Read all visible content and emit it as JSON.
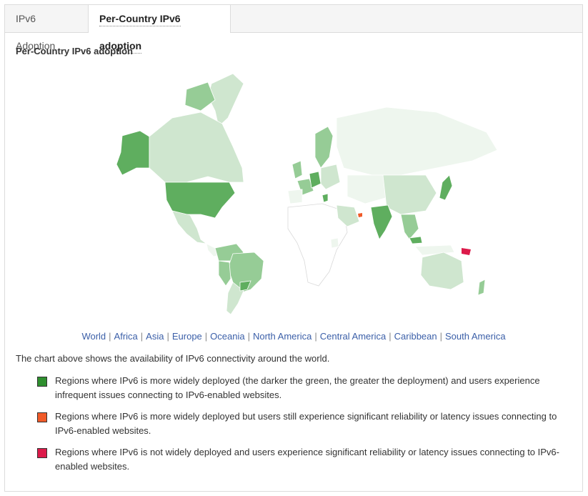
{
  "tabs": [
    {
      "label": "IPv6 Adoption"
    },
    {
      "label": "Per-Country IPv6 adoption"
    }
  ],
  "section_title": "Per-Country IPv6 adoption",
  "colors": {
    "high": "#5fae5f",
    "mid": "#96cc96",
    "low": "#cfe6cf",
    "minimal": "#eef6ee",
    "none": "#ffffff",
    "issues_orange": "#f05a28",
    "issues_red": "#e0194d"
  },
  "region_links": [
    "World",
    "Africa",
    "Asia",
    "Europe",
    "Oceania",
    "North America",
    "Central America",
    "Caribbean",
    "South America"
  ],
  "description": "The chart above shows the availability of IPv6 connectivity around the world.",
  "legend": [
    {
      "color": "#2f8f2f",
      "text": "Regions where IPv6 is more widely deployed (the darker the green, the greater the deployment) and users experience infrequent issues connecting to IPv6-enabled websites."
    },
    {
      "color": "#f05a28",
      "text": "Regions where IPv6 is more widely deployed but users still experience significant reliability or latency issues connecting to IPv6-enabled websites."
    },
    {
      "color": "#dc1a4a",
      "text": "Regions where IPv6 is not widely deployed and users experience significant reliability or latency issues connecting to IPv6-enabled websites."
    }
  ]
}
